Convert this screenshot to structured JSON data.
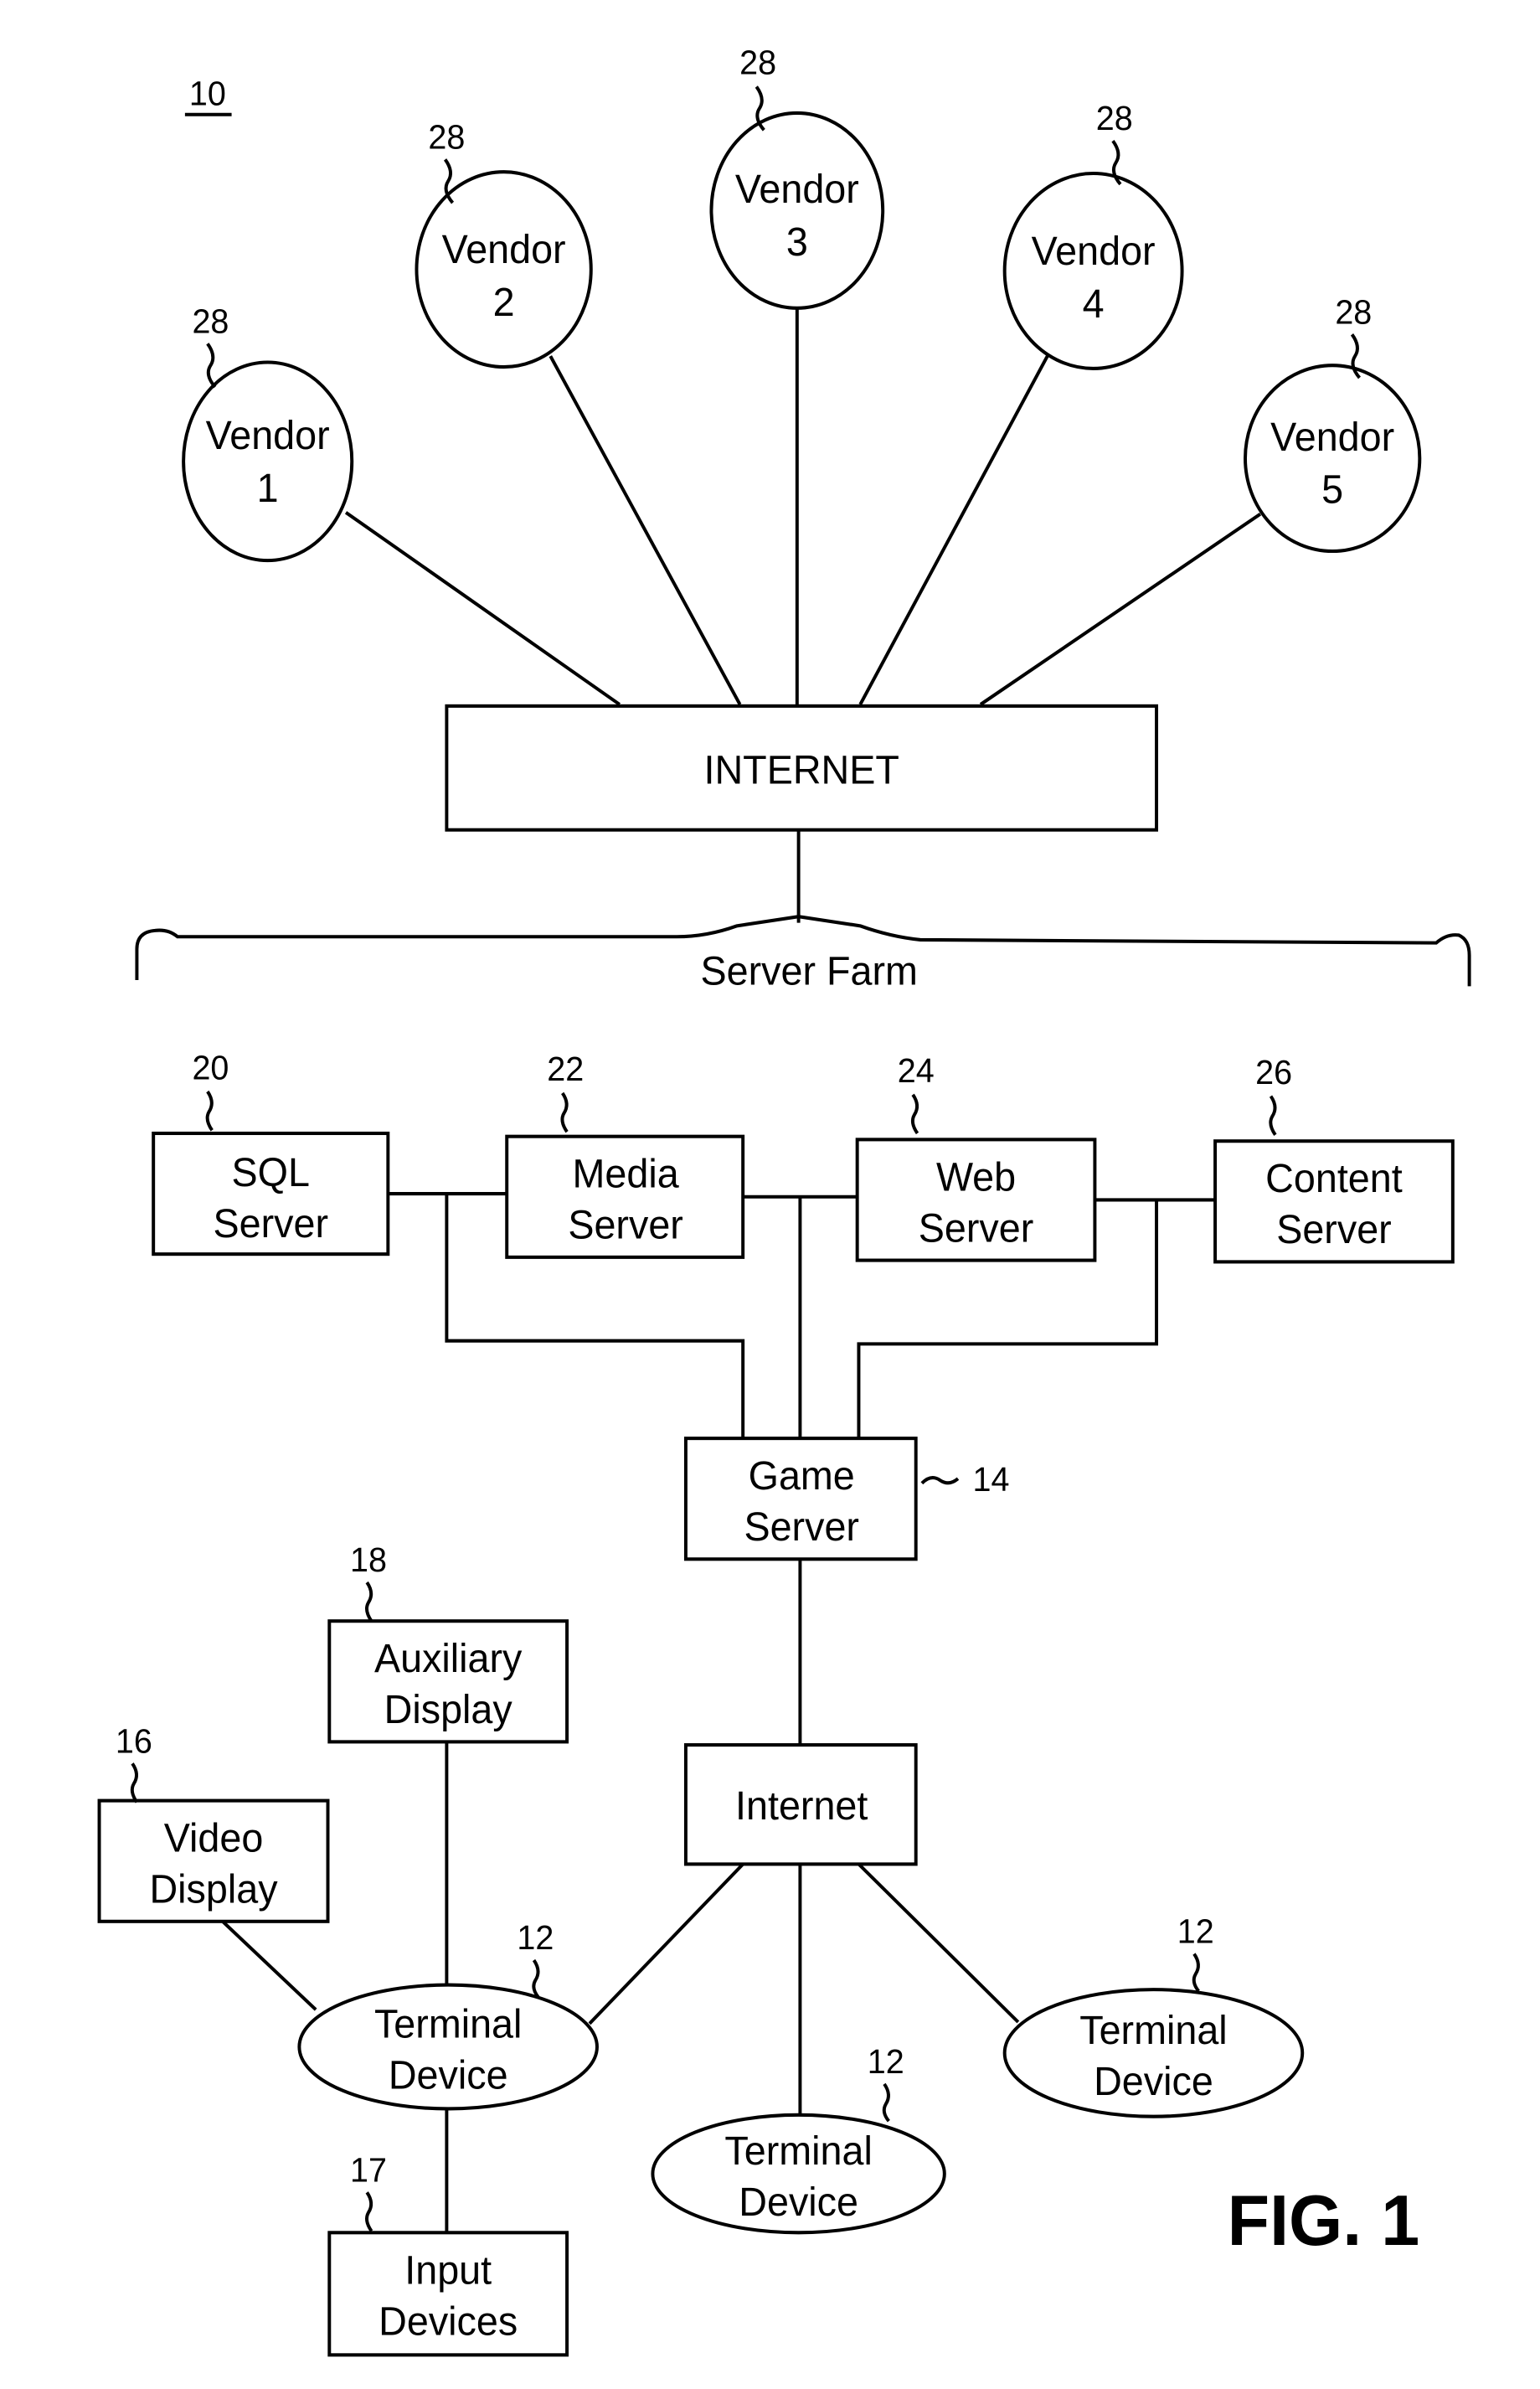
{
  "figure": {
    "number_label": "FIG. 1",
    "system_ref": "10"
  },
  "vendors": [
    {
      "line1": "Vendor",
      "line2": "1",
      "ref": "28"
    },
    {
      "line1": "Vendor",
      "line2": "2",
      "ref": "28"
    },
    {
      "line1": "Vendor",
      "line2": "3",
      "ref": "28"
    },
    {
      "line1": "Vendor",
      "line2": "4",
      "ref": "28"
    },
    {
      "line1": "Vendor",
      "line2": "5",
      "ref": "28"
    }
  ],
  "internet_top": {
    "label": "INTERNET"
  },
  "server_farm": {
    "label": "Server Farm"
  },
  "servers": [
    {
      "line1": "SQL",
      "line2": "Server",
      "ref": "20"
    },
    {
      "line1": "Media",
      "line2": "Server",
      "ref": "22"
    },
    {
      "line1": "Web",
      "line2": "Server",
      "ref": "24"
    },
    {
      "line1": "Content",
      "line2": "Server",
      "ref": "26"
    }
  ],
  "game_server": {
    "line1": "Game",
    "line2": "Server",
    "ref": "14"
  },
  "internet_bottom": {
    "label": "Internet"
  },
  "auxiliary_display": {
    "line1": "Auxiliary",
    "line2": "Display",
    "ref": "18"
  },
  "video_display": {
    "line1": "Video",
    "line2": "Display",
    "ref": "16"
  },
  "input_devices": {
    "line1": "Input",
    "line2": "Devices",
    "ref": "17"
  },
  "terminals": [
    {
      "line1": "Terminal",
      "line2": "Device",
      "ref": "12"
    },
    {
      "line1": "Terminal",
      "line2": "Device",
      "ref": "12"
    },
    {
      "line1": "Terminal",
      "line2": "Device",
      "ref": "12"
    }
  ]
}
